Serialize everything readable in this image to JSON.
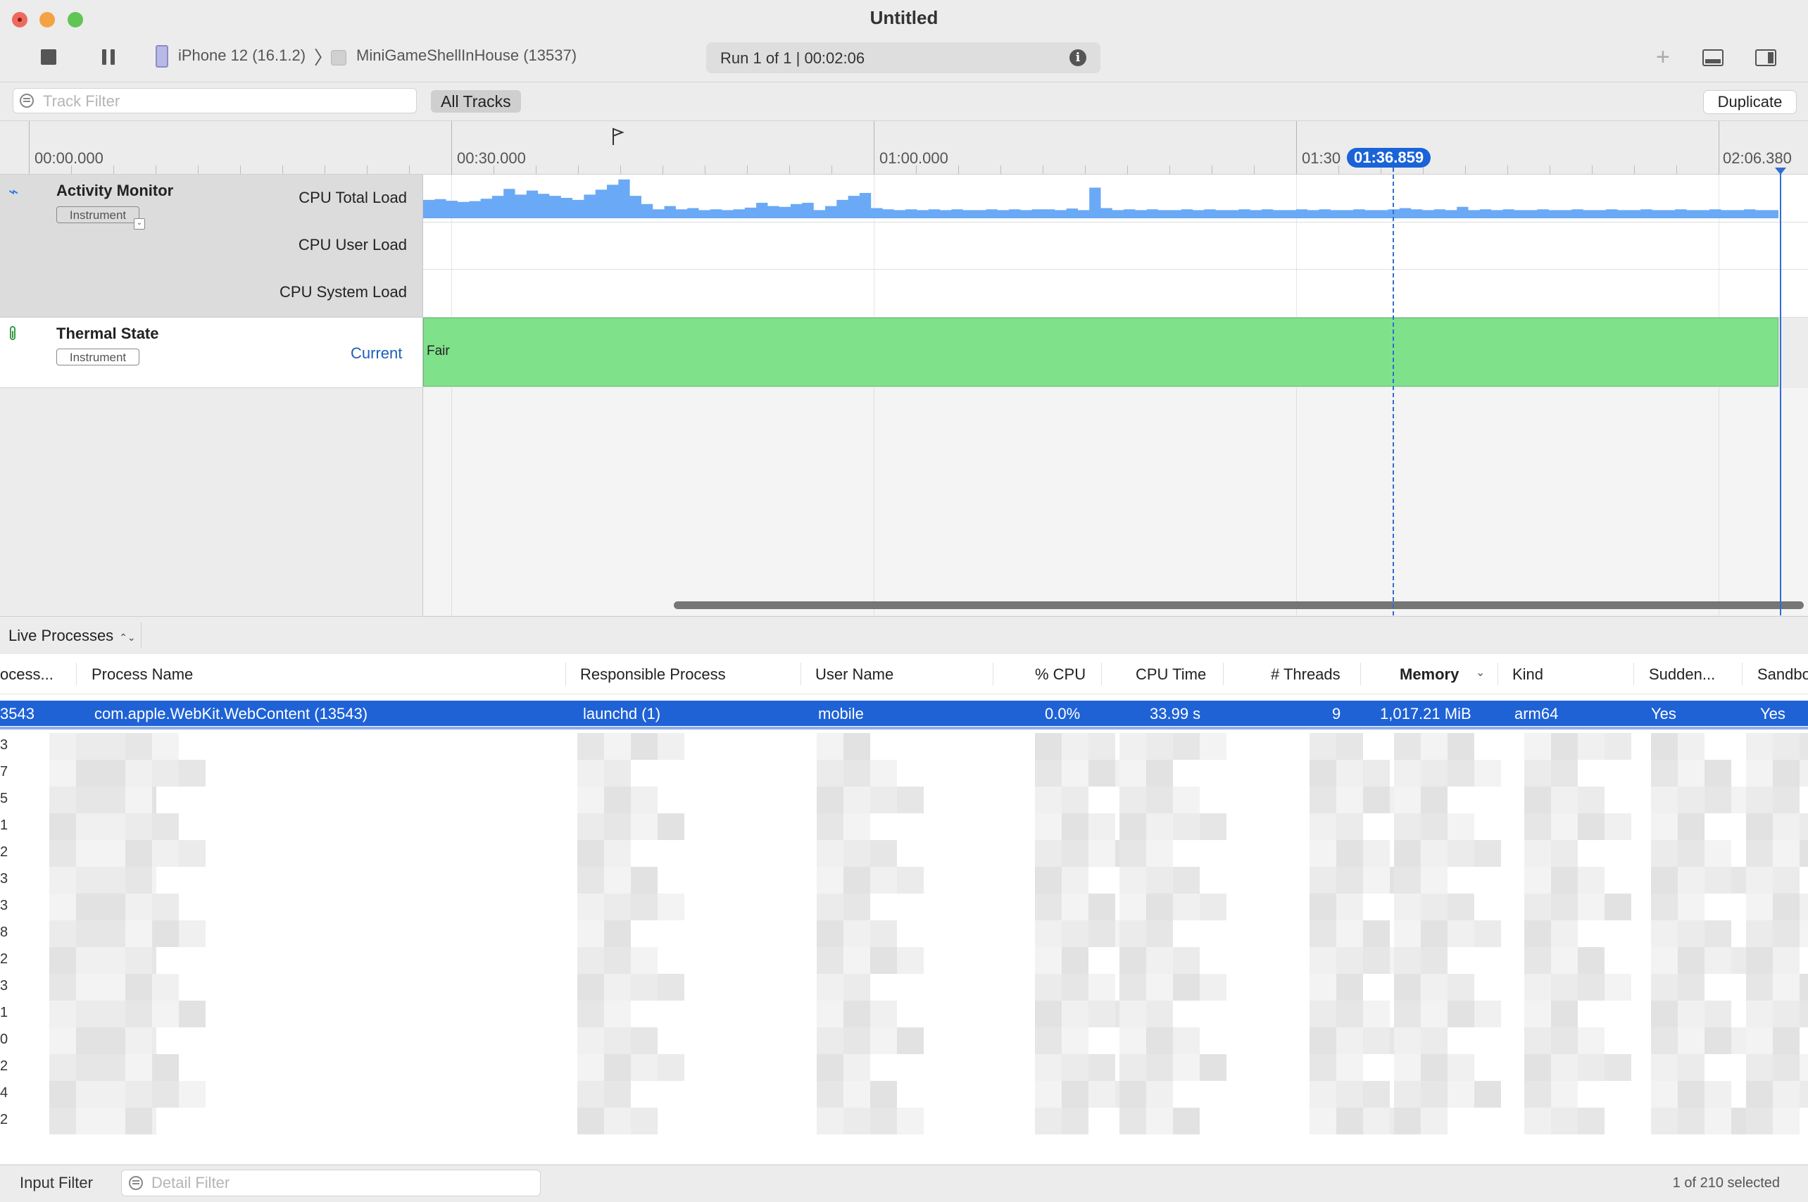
{
  "window": {
    "title": "Untitled"
  },
  "toolbar": {
    "device": "iPhone 12 (16.1.2)",
    "separator": "〉",
    "target": "MiniGameShellInHouse (13537)",
    "run_status": "Run 1 of 1  |  00:02:06"
  },
  "filterbar": {
    "track_filter_placeholder": "Track Filter",
    "all_tracks_label": "All Tracks",
    "duplicate_label": "Duplicate"
  },
  "ruler": {
    "labels": [
      "00:00.000",
      "00:30.000",
      "01:00.000",
      "01:30",
      "02:06.380"
    ],
    "inspection_time": "01:36.859"
  },
  "tracks": {
    "activity_monitor": {
      "name": "Activity Monitor",
      "badge": "Instrument",
      "sublanes": [
        "CPU Total Load",
        "CPU User Load",
        "CPU System Load"
      ]
    },
    "thermal_state": {
      "name": "Thermal State",
      "badge": "Instrument",
      "sublane": "Current",
      "state": "Fair"
    }
  },
  "chart_data": {
    "type": "area",
    "series": [
      {
        "name": "CPU Total Load",
        "values": [
          0.45,
          0.47,
          0.43,
          0.4,
          0.42,
          0.48,
          0.55,
          0.72,
          0.58,
          0.68,
          0.6,
          0.55,
          0.5,
          0.45,
          0.58,
          0.7,
          0.82,
          0.95,
          0.55,
          0.35,
          0.22,
          0.3,
          0.22,
          0.25,
          0.2,
          0.22,
          0.2,
          0.22,
          0.26,
          0.38,
          0.3,
          0.28,
          0.35,
          0.38,
          0.2,
          0.3,
          0.45,
          0.55,
          0.62,
          0.25,
          0.22,
          0.2,
          0.22,
          0.2,
          0.22,
          0.2,
          0.22,
          0.2,
          0.2,
          0.22,
          0.2,
          0.22,
          0.2,
          0.22,
          0.22,
          0.2,
          0.24,
          0.2,
          0.75,
          0.25,
          0.2,
          0.22,
          0.2,
          0.22,
          0.2,
          0.2,
          0.22,
          0.2,
          0.22,
          0.2,
          0.2,
          0.22,
          0.2,
          0.22,
          0.2,
          0.2,
          0.22,
          0.2,
          0.22,
          0.2,
          0.2,
          0.22,
          0.2,
          0.2,
          0.22,
          0.25,
          0.22,
          0.2,
          0.22,
          0.2,
          0.28,
          0.2,
          0.22,
          0.2,
          0.22,
          0.2,
          0.2,
          0.22,
          0.2,
          0.2,
          0.22,
          0.2,
          0.2,
          0.22,
          0.2,
          0.2,
          0.22,
          0.2,
          0.2,
          0.22,
          0.2,
          0.2,
          0.22,
          0.2,
          0.2,
          0.22,
          0.2,
          0.2
        ]
      }
    ]
  },
  "detail": {
    "view_selector": "Live Processes",
    "columns": [
      "ocess...",
      "Process Name",
      "Responsible Process",
      "User Name",
      "% CPU",
      "CPU Time",
      "# Threads",
      "Memory",
      "Kind",
      "Sudden...",
      "Sandbo"
    ],
    "selected_row": {
      "pid": "3543",
      "process_name": "com.apple.WebKit.WebContent (13543)",
      "responsible": "launchd (1)",
      "user": "mobile",
      "cpu": "0.0%",
      "cpu_time": "33.99 s",
      "threads": "9",
      "memory": "1,017.21 MiB",
      "kind": "arm64",
      "sudden": "Yes",
      "sandbox": "Yes"
    },
    "partial_row_digits": [
      "3",
      "7",
      "5",
      "1",
      "2",
      "3",
      "3",
      "8",
      "2",
      "3",
      "1",
      "0",
      "2",
      "4",
      "2"
    ]
  },
  "statusbar": {
    "input_filter_label": "Input Filter",
    "detail_filter_placeholder": "Detail Filter",
    "selection_count": "1 of 210 selected"
  },
  "colors": {
    "accent": "#1f62d6",
    "cpu_fill": "#6aa9f5",
    "thermal_fair": "#80e18b"
  }
}
